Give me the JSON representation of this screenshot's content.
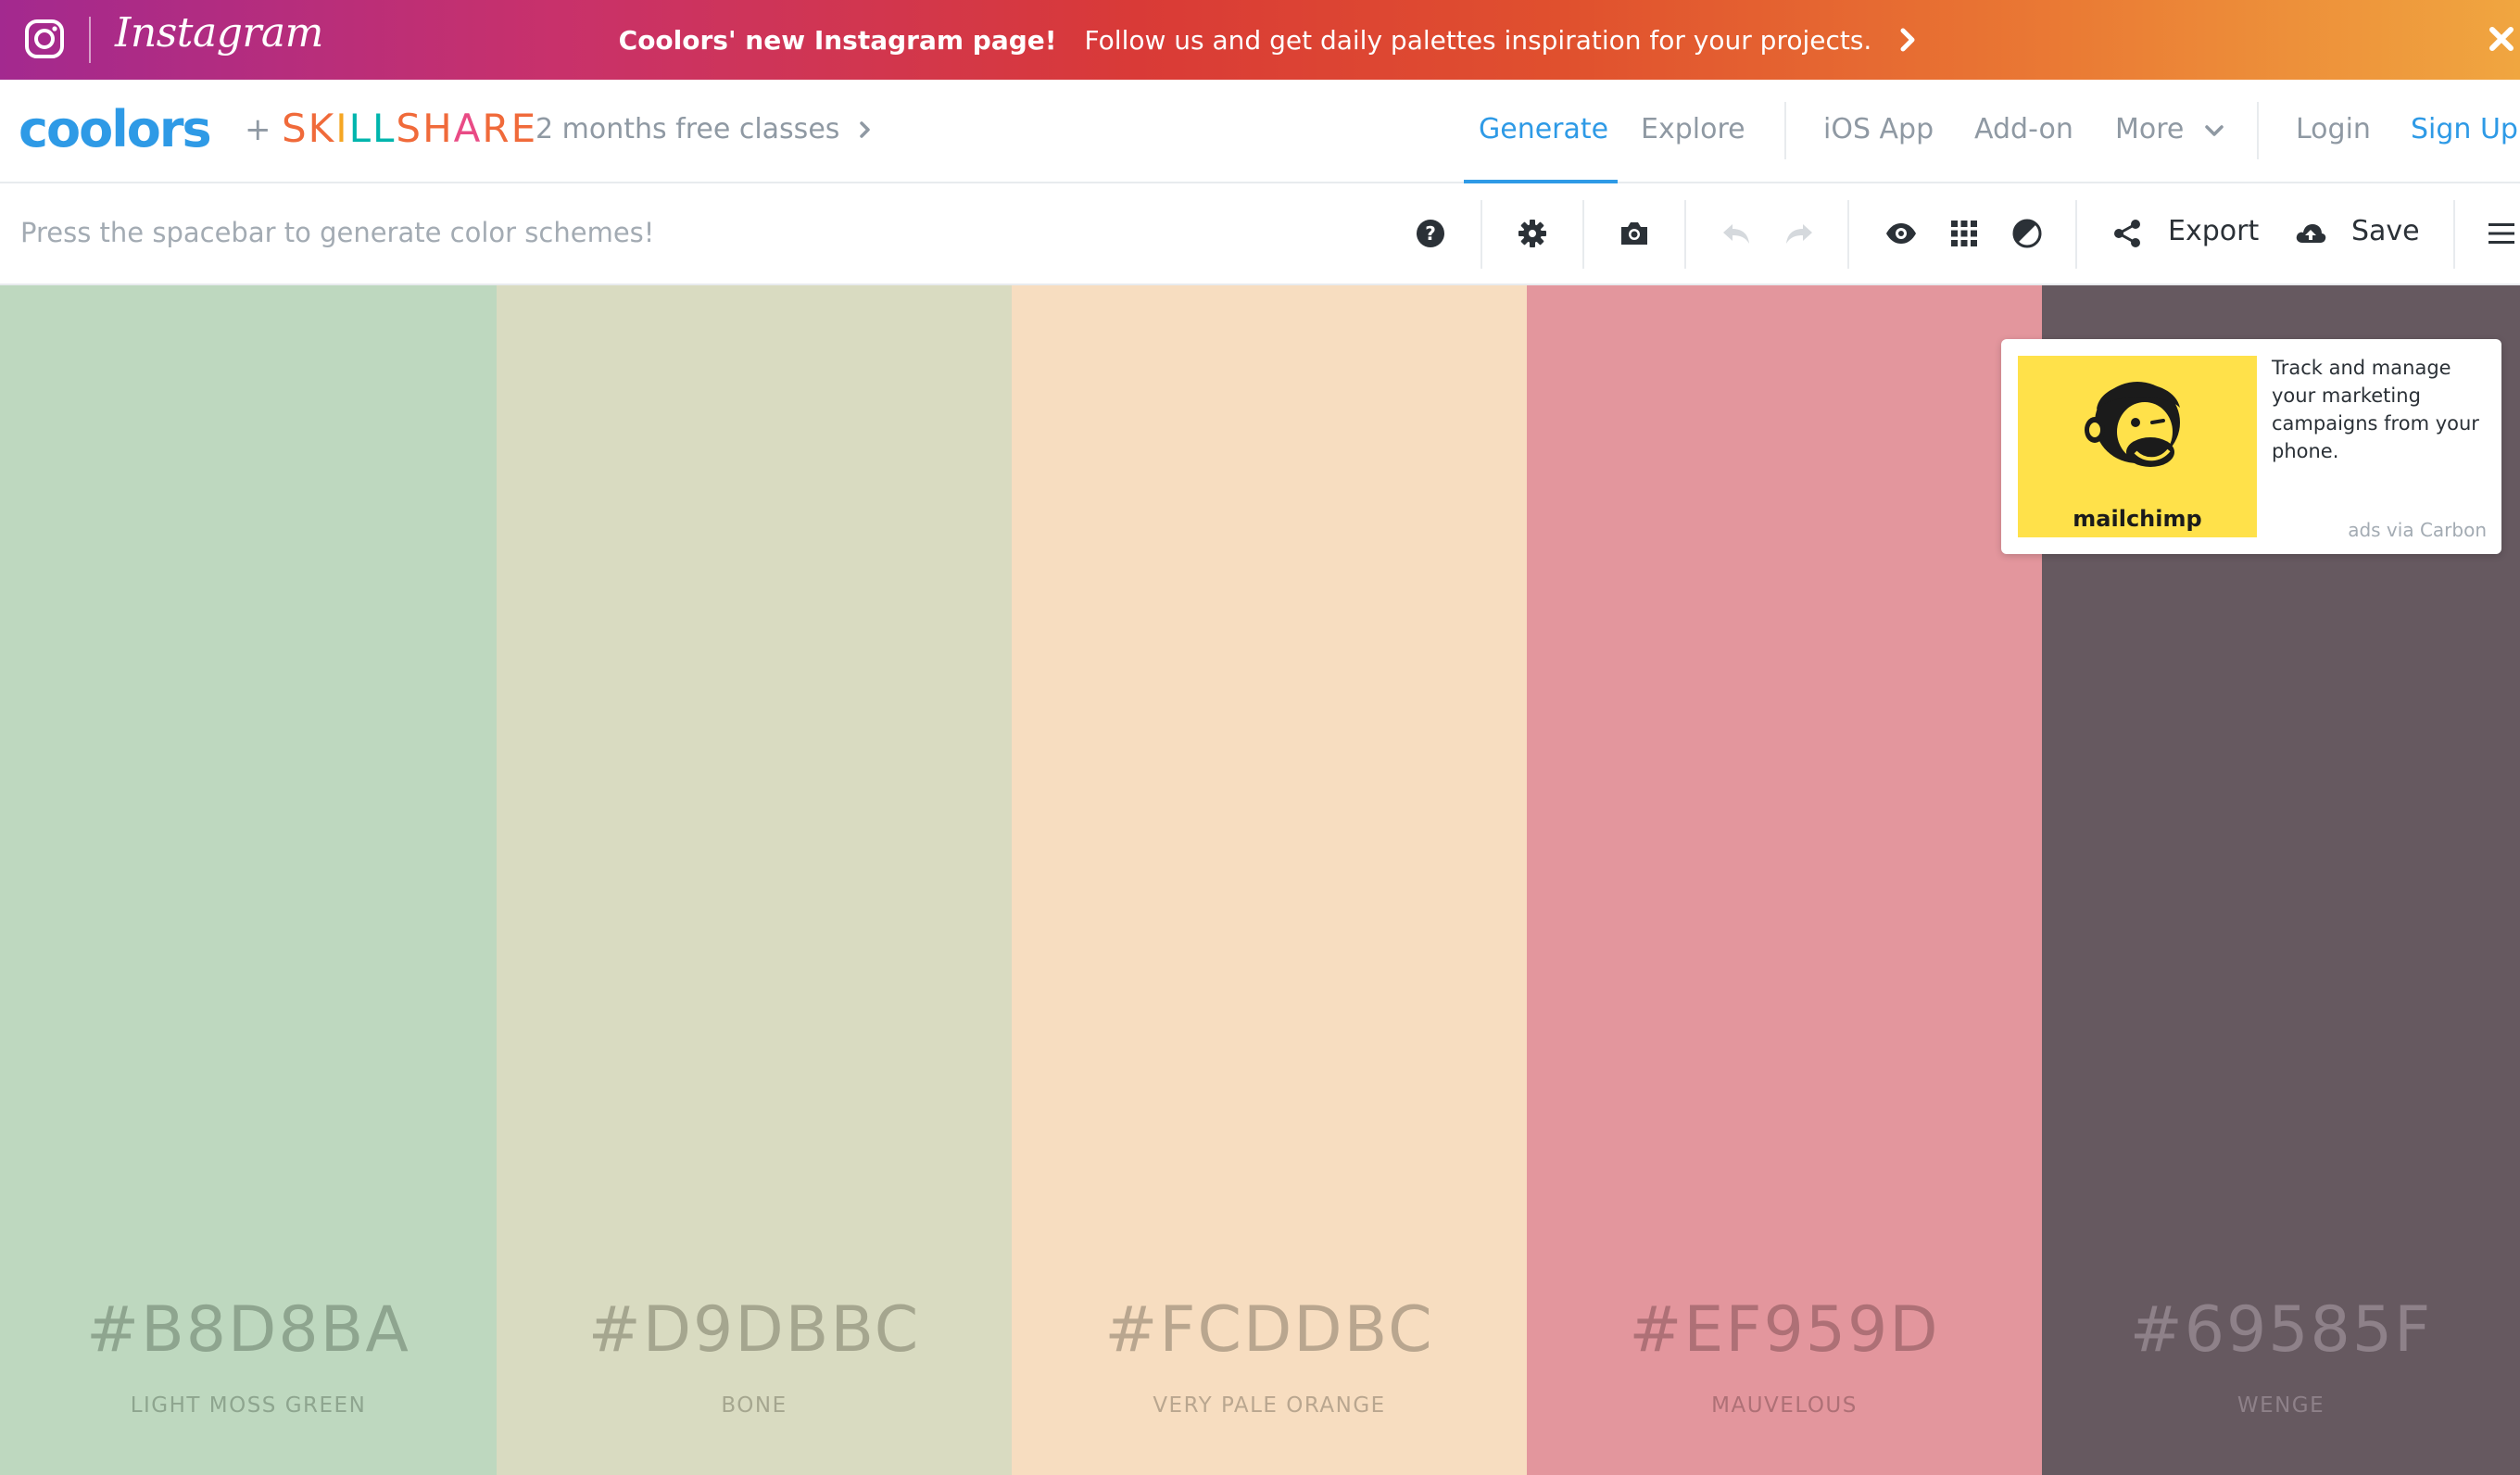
{
  "promo": {
    "brand": "Instagram",
    "headline": "Coolors' new Instagram page!",
    "message": "Follow us and get daily palettes inspiration for your projects."
  },
  "header": {
    "logo": "coolors",
    "plus": "+",
    "partner": {
      "p1": "SK",
      "p2": "I",
      "p3": "LL",
      "p4": "SH",
      "p5": "A",
      "p6": "RE"
    },
    "promo_link": "2 months free classes",
    "nav": {
      "generate": "Generate",
      "explore": "Explore",
      "ios_app": "iOS App",
      "add_on": "Add-on",
      "more": "More",
      "login": "Login",
      "signup": "Sign Up"
    }
  },
  "toolbar": {
    "hint": "Press the spacebar to generate color schemes!",
    "export_label": "Export",
    "save_label": "Save",
    "icons": [
      "help-icon",
      "settings-icon",
      "camera-icon",
      "undo-icon",
      "redo-icon",
      "view-icon",
      "grid-icon",
      "adjust-icon",
      "share-icon",
      "cloud-upload-icon",
      "menu-icon"
    ]
  },
  "palette": [
    {
      "hex": "#B8D8BA",
      "name": "LIGHT MOSS GREEN",
      "bg": "#bed8bf",
      "text_color": "#8ea58f",
      "label_color": "#8ea58f"
    },
    {
      "hex": "#D9DBBC",
      "name": "BONE",
      "bg": "#d9dbc1",
      "text_color": "#a5a68f",
      "label_color": "#a5a68f"
    },
    {
      "hex": "#FCDDBC",
      "name": "VERY PALE ORANGE",
      "bg": "#f7ddc0",
      "text_color": "#b9a68f",
      "label_color": "#b9a68f"
    },
    {
      "hex": "#EF959D",
      "name": "MAUVELOUS",
      "bg": "#e3969d",
      "text_color": "#ae7076",
      "label_color": "#ae7076"
    },
    {
      "hex": "#69585F",
      "name": "WENGE",
      "bg": "#665960",
      "text_color": "#8e8189",
      "label_color": "#8e8189"
    }
  ],
  "ad": {
    "brand": "mailchimp",
    "text": "Track and manage your marketing campaigns from your phone.",
    "via": "ads via Carbon"
  },
  "colors": {
    "accent": "#2e9ae6",
    "muted": "#8f99a3",
    "ad_bg": "#ffe14a"
  }
}
